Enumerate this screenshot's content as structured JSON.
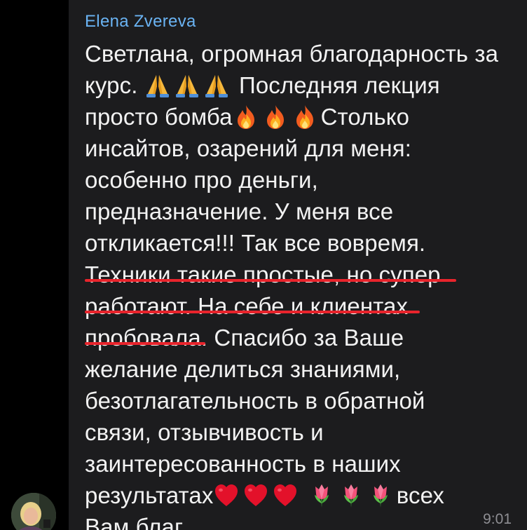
{
  "chat": {
    "sender_name": "Elena Zvereva",
    "sender_color": "#6ab3f3",
    "avatar_icon": "avatar-photo",
    "time": "9:01",
    "message_lines": [
      {
        "segments": [
          {
            "text": "Светлана, огромная благодарность за"
          }
        ]
      },
      {
        "segments": [
          {
            "text": "курс. "
          },
          {
            "emoji": "pray-icon"
          },
          {
            "emoji": "pray-icon"
          },
          {
            "emoji": "pray-icon"
          },
          {
            "text": " Последняя лекция"
          }
        ]
      },
      {
        "segments": [
          {
            "text": "просто бомба"
          },
          {
            "emoji": "fire-icon"
          },
          {
            "emoji": "fire-icon"
          },
          {
            "emoji": "fire-icon"
          },
          {
            "text": "Столько"
          }
        ]
      },
      {
        "segments": [
          {
            "text": "инсайтов, озарений для меня:"
          }
        ]
      },
      {
        "segments": [
          {
            "text": "особенно про деньги,"
          }
        ]
      },
      {
        "segments": [
          {
            "text": "предназначение. У меня все"
          }
        ]
      },
      {
        "segments": [
          {
            "text": "откликается!!! Так все вовремя."
          }
        ]
      },
      {
        "segments": [
          {
            "text": "Техники такие простые, но супер"
          }
        ]
      },
      {
        "segments": [
          {
            "text": "работают. На себе и клиентах"
          }
        ]
      },
      {
        "segments": [
          {
            "text": "пробовала. Спасибо за Ваше"
          }
        ]
      },
      {
        "segments": [
          {
            "text": "желание делиться знаниями,"
          }
        ]
      },
      {
        "segments": [
          {
            "text": "безотлагательность в обратной"
          }
        ]
      },
      {
        "segments": [
          {
            "text": "связи, отзывчивость и"
          }
        ]
      },
      {
        "segments": [
          {
            "text": "заинтересованность в наших"
          }
        ]
      },
      {
        "segments": [
          {
            "text": "результатах"
          },
          {
            "emoji": "heart-icon"
          },
          {
            "emoji": "heart-icon"
          },
          {
            "emoji": "heart-icon"
          },
          {
            "text": " "
          },
          {
            "emoji": "tulip-icon"
          },
          {
            "emoji": "tulip-icon"
          },
          {
            "emoji": "tulip-icon"
          },
          {
            "text": "всех"
          }
        ]
      },
      {
        "segments": [
          {
            "text": "Вам благ"
          }
        ]
      }
    ],
    "highlight_color": "#e8242c",
    "highlighted_text": [
      "Техники такие простые, но супер",
      "работают. На себе и клиентах",
      "пробовала."
    ]
  }
}
